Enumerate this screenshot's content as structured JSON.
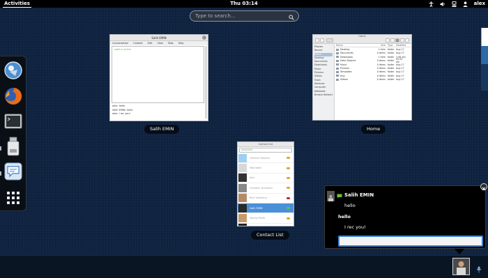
{
  "topbar": {
    "activities_label": "Activities",
    "clock": "Thu 03:14",
    "username": "alex",
    "icons": [
      "accessibility-icon",
      "volume-icon",
      "network-icon",
      "user-icon"
    ]
  },
  "search": {
    "placeholder": "Type to search...",
    "value": ""
  },
  "dash": {
    "apps": [
      {
        "name": "empathy-icon"
      },
      {
        "name": "firefox-icon"
      },
      {
        "name": "terminal-icon"
      },
      {
        "name": "removable-drive-icon"
      },
      {
        "name": "chat-bubble-icon"
      },
      {
        "name": "show-apps-grid-icon"
      }
    ]
  },
  "windows": {
    "chat": {
      "caption": "Salih EMIN",
      "titlebar": "Salih EMIN",
      "menu": [
        "Conversation",
        "Contact",
        "Edit",
        "View",
        "Tabs",
        "Help"
      ],
      "status_line": "salih is online",
      "lines": [
        "alex: hello",
        "Salih EMIN: hello",
        "alex: i rec you!"
      ]
    },
    "files": {
      "caption": "Home",
      "title": "Home",
      "sidebar": [
        {
          "label": "Places",
          "header": true
        },
        {
          "label": "Recent"
        },
        {
          "label": "Home",
          "selected": true
        },
        {
          "label": "Desktop"
        },
        {
          "label": "Documents"
        },
        {
          "label": "Downloads"
        },
        {
          "label": "Music"
        },
        {
          "label": "Pictures"
        },
        {
          "label": "Videos"
        },
        {
          "label": "Trash"
        },
        {
          "label": "Devices",
          "header": true
        },
        {
          "label": "Computer"
        },
        {
          "label": "Network",
          "header": true
        },
        {
          "label": "Browse Network"
        }
      ],
      "columns": [
        "Name",
        "Size",
        "Type",
        "Modified"
      ],
      "rows": [
        [
          "Desktop",
          "1 item",
          "folder",
          "Aug 17"
        ],
        [
          "Documents",
          "0 items",
          "folder",
          "Aug 17"
        ],
        [
          "Downloads",
          "1 item",
          "folder",
          "1:56 am"
        ],
        [
          "Hello Skoonie",
          "0 items",
          "folder",
          "02:52 am"
        ],
        [
          "Music",
          "0 items",
          "folder",
          "Aug 17"
        ],
        [
          "Pictures",
          "0 items",
          "folder",
          "Aug 17"
        ],
        [
          "Templates",
          "0 items",
          "folder",
          "Aug 17"
        ],
        [
          "tmp",
          "0 items",
          "folder",
          "Aug 17"
        ],
        [
          "Videos",
          "0 items",
          "folder",
          "Aug 17"
        ]
      ]
    },
    "contacts": {
      "caption": "Contact List",
      "title": "Contact List",
      "filter": "Available",
      "rows": [
        {
          "name": "Günther Rasmus",
          "status": "#e8a02a",
          "avatar": "#9ed0f2"
        },
        {
          "name": "Mauraden",
          "status": "#e8a02a",
          "avatar": "#d8d8d8"
        },
        {
          "name": "Alex",
          "status": "#e8a02a",
          "avatar": "#333333"
        },
        {
          "name": "Christian Dumoulin",
          "status": "#e8a02a",
          "avatar": "#888888"
        },
        {
          "name": "Rick Valentino",
          "status": "#cc2222",
          "avatar": "#b48a66"
        },
        {
          "name": "Salih EMIN",
          "status": "#6bbf3b",
          "avatar": "#2a2a2a",
          "selected": true
        },
        {
          "name": "Yannig Marie",
          "status": "#e8a02a",
          "avatar": "#c69a6c"
        },
        {
          "name": "Jordan Mantha",
          "status": "#6bbf3b",
          "avatar": "#222222"
        }
      ]
    }
  },
  "notification": {
    "title": "Salih EMIN",
    "messages": [
      {
        "text": "hello",
        "indent": true,
        "bold": false
      },
      {
        "text": "hello",
        "indent": false,
        "bold": true
      },
      {
        "text": "I rec you!",
        "indent": true,
        "bold": false
      }
    ],
    "reply_value": "",
    "accent": "#3c83d8",
    "status_color": "#6bbf3b"
  }
}
